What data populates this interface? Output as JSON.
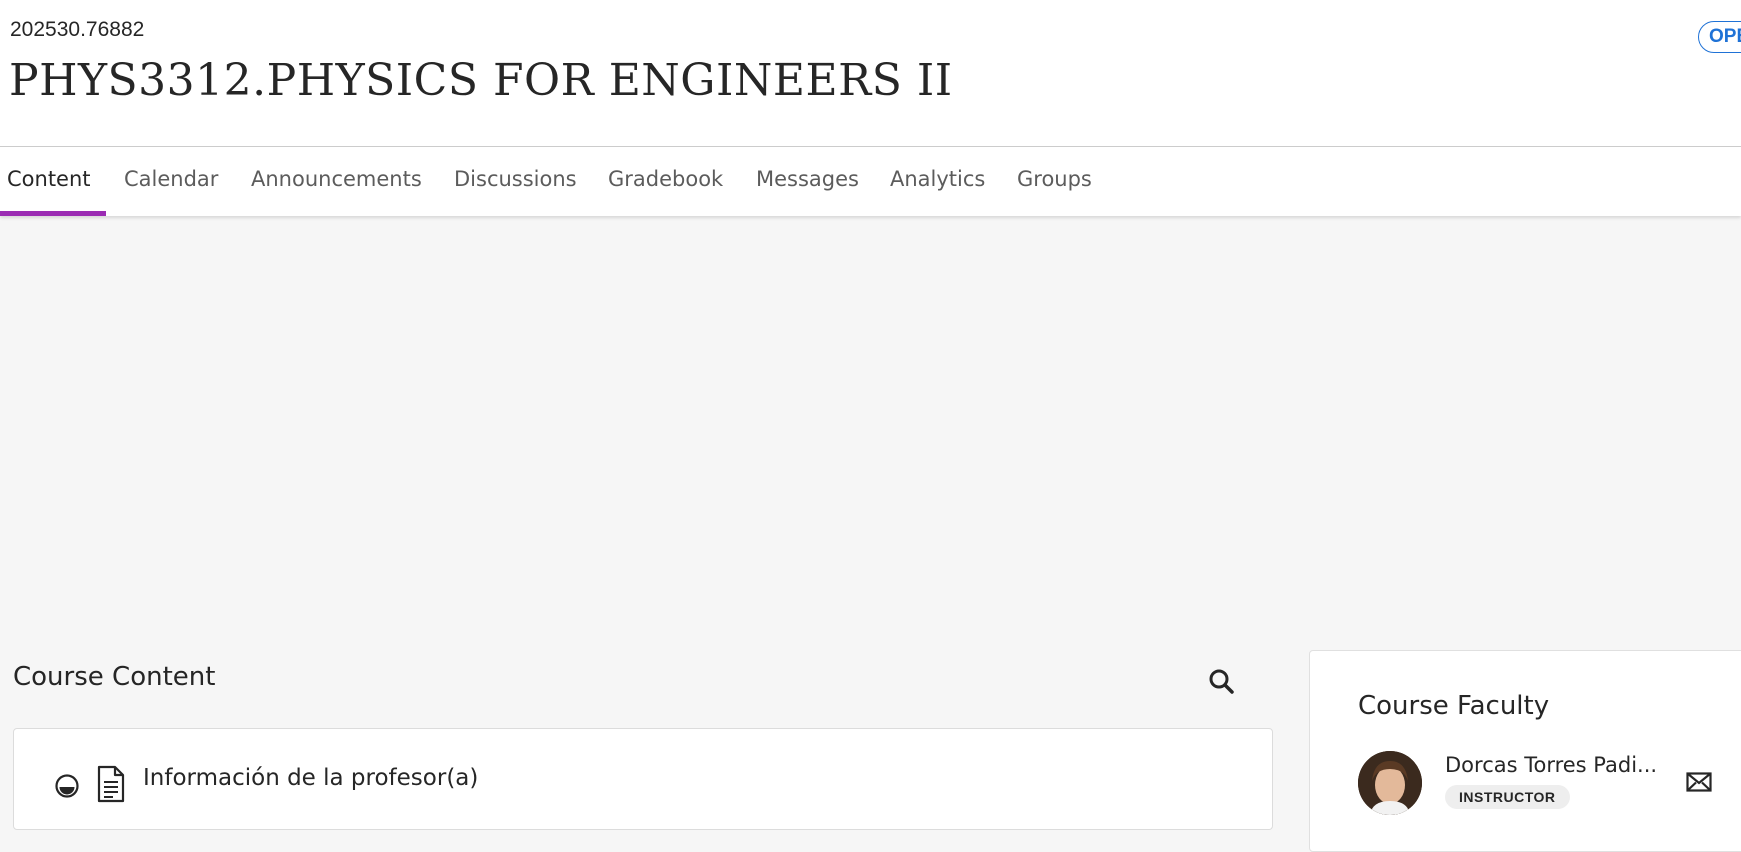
{
  "header": {
    "course_id": "202530.76882",
    "course_title": "PHYS3312.PHYSICS FOR ENGINEERS II",
    "status_badge": "OPEN"
  },
  "tabs": [
    {
      "label": "Content",
      "active": true
    },
    {
      "label": "Calendar"
    },
    {
      "label": "Announcements"
    },
    {
      "label": "Discussions"
    },
    {
      "label": "Gradebook"
    },
    {
      "label": "Messages"
    },
    {
      "label": "Analytics"
    },
    {
      "label": "Groups"
    }
  ],
  "course_content": {
    "title": "Course Content",
    "search_icon": "search-icon",
    "items": [
      {
        "title": "Información de la profesor(a)",
        "status_icon": "half-filled-circle-icon",
        "type_icon": "document-icon"
      }
    ]
  },
  "faculty": {
    "title": "Course Faculty",
    "members": [
      {
        "name": "Dorcas Torres Padi...",
        "role": "INSTRUCTOR",
        "action_icon": "mail-icon"
      }
    ]
  },
  "colors": {
    "active_tab_underline": "#9b2cb3",
    "badge_blue": "#1f72d6",
    "page_background": "#f6f6f6"
  }
}
